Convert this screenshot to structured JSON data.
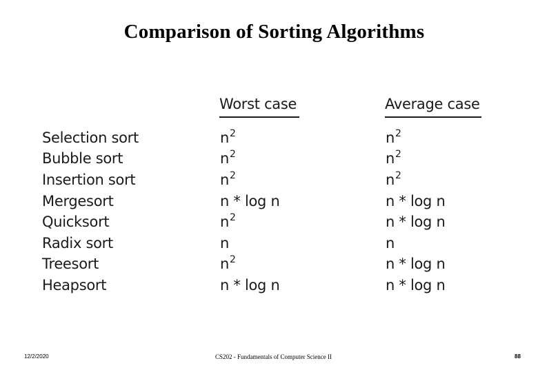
{
  "slide": {
    "title": "Comparison of Sorting Algorithms"
  },
  "table": {
    "headers": {
      "algorithm": "",
      "worst_case": "Worst case",
      "average_case": "Average case"
    },
    "rows": [
      {
        "algorithm": "Selection sort",
        "worst": {
          "base": "n",
          "exp": "2"
        },
        "average": {
          "base": "n",
          "exp": "2"
        }
      },
      {
        "algorithm": "Bubble sort",
        "worst": {
          "base": "n",
          "exp": "2"
        },
        "average": {
          "base": "n",
          "exp": "2"
        }
      },
      {
        "algorithm": "Insertion sort",
        "worst": {
          "base": "n",
          "exp": "2"
        },
        "average": {
          "base": "n",
          "exp": "2"
        }
      },
      {
        "algorithm": "Mergesort",
        "worst": {
          "base": "n * log n",
          "exp": ""
        },
        "average": {
          "base": "n * log n",
          "exp": ""
        }
      },
      {
        "algorithm": "Quicksort",
        "worst": {
          "base": "n",
          "exp": "2"
        },
        "average": {
          "base": "n * log n",
          "exp": ""
        }
      },
      {
        "algorithm": "Radix sort",
        "worst": {
          "base": "n",
          "exp": ""
        },
        "average": {
          "base": "n",
          "exp": ""
        }
      },
      {
        "algorithm": "Treesort",
        "worst": {
          "base": "n",
          "exp": "2"
        },
        "average": {
          "base": "n * log n",
          "exp": ""
        }
      },
      {
        "algorithm": "Heapsort",
        "worst": {
          "base": "n * log n",
          "exp": ""
        },
        "average": {
          "base": "n * log n",
          "exp": ""
        }
      }
    ]
  },
  "footer": {
    "date": "12/2/2020",
    "course": "CS202 - Fundamentals of Computer Science II",
    "page_number": "88"
  }
}
